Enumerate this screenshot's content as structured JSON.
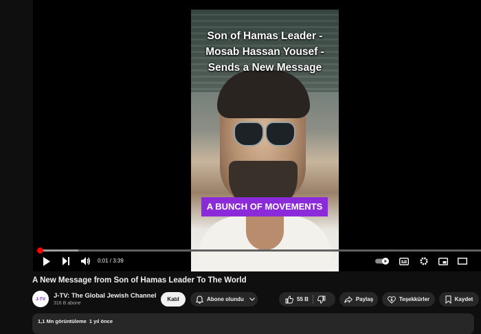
{
  "video_overlay": {
    "title_lines": [
      "Son of Hamas Leader -",
      "Mosab Hassan Yousef -",
      "Sends a New Message"
    ],
    "caption": "A BUNCH OF MOVEMENTS"
  },
  "player": {
    "progress": 0.004,
    "buffered": 0.09,
    "current_time": "0:01",
    "separator": " / ",
    "duration": "3:39",
    "icons": [
      "play-icon",
      "next-icon",
      "volume-icon",
      "autoplay-toggle",
      "subtitles-icon",
      "settings-icon",
      "miniplayer-icon",
      "theater-icon"
    ],
    "accent_color": "#ff0000"
  },
  "video": {
    "title": "A New Message from Son of Hamas Leader To The World"
  },
  "channel": {
    "avatar_text": "J-TV",
    "name": "J-TV: The Global Jewish Channel",
    "subscribers": "316 B abone",
    "join_label": "Katıl",
    "subscribed_label": "Abone olundu"
  },
  "actions": {
    "like_count": "55 B",
    "share_label": "Paylaş",
    "thanks_label": "Teşekkürler",
    "save_label": "Kaydet"
  },
  "description": {
    "views": "1,1 Mn görüntüleme",
    "age": "1 yıl önce"
  }
}
